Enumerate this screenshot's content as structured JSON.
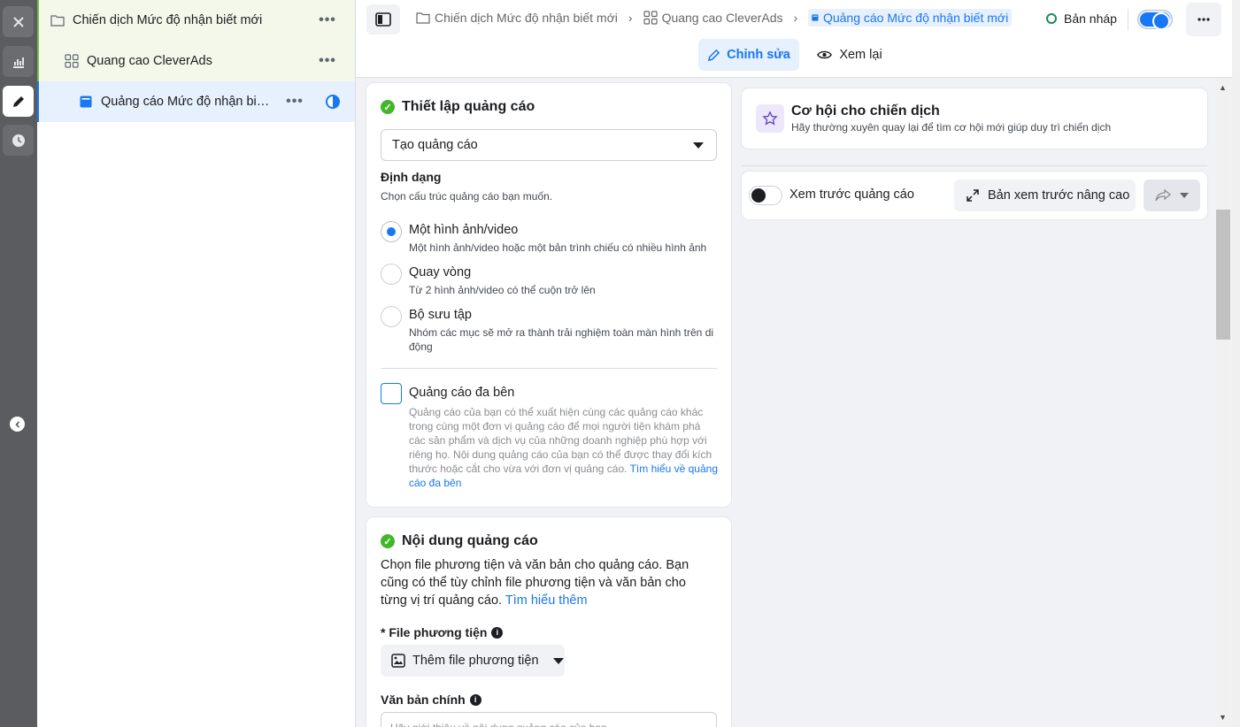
{
  "tree": {
    "campaign": "Chiến dịch Mức độ nhận biết mới",
    "adset": "Quang cao CleverAds",
    "ad": "Quảng cáo Mức độ nhận biết ..."
  },
  "topbar": {
    "breadcrumbs": [
      "Chiến dịch Mức độ nhận biết mới",
      "Quang cao CleverAds",
      "Quảng cáo Mức độ nhận biết mới"
    ],
    "status": "Bản nháp",
    "mode_edit": "Chỉnh sửa",
    "mode_review": "Xem lại"
  },
  "setup": {
    "title": "Thiết lập quảng cáo",
    "create_select": "Tạo quảng cáo",
    "format_heading": "Định dạng",
    "format_sub": "Chọn cấu trúc quảng cáo bạn muốn.",
    "options": [
      {
        "label": "Một hình ảnh/video",
        "desc": "Một hình ảnh/video hoặc một bản trình chiếu có nhiều hình ảnh",
        "selected": true
      },
      {
        "label": "Quay vòng",
        "desc": "Từ 2 hình ảnh/video có thể cuộn trở lên",
        "selected": false
      },
      {
        "label": "Bộ sưu tập",
        "desc": "Nhóm các mục sẽ mở ra thành trải nghiệm toàn màn hình trên di động",
        "selected": false
      }
    ],
    "multi_ad_label": "Quảng cáo đa bên",
    "multi_ad_desc": "Quảng cáo của bạn có thể xuất hiện cùng các quảng cáo khác trong cùng một đơn vị quảng cáo để mọi người tiện khám phá các sản phẩm và dịch vụ của những doanh nghiệp phù hợp với riêng họ. Nội dung quảng cáo của bạn có thể được thay đổi kích thước hoặc cắt cho vừa với đơn vị quảng cáo.",
    "multi_ad_link": "Tìm hiểu về quảng cáo đa bên"
  },
  "content": {
    "title": "Nội dung quảng cáo",
    "desc": "Chọn file phương tiện và văn bản cho quảng cáo. Bạn cũng có thể tùy chỉnh file phương tiện và văn bản cho từng vị trí quảng cáo.",
    "learn_more": "Tìm hiểu thêm",
    "media_label": "* File phương tiện",
    "media_button": "Thêm file phương tiện",
    "primary_text_label": "Văn bản chính",
    "primary_text_placeholder": "Hãy giới thiệu về nội dung quảng cáo của bạn"
  },
  "opportunity": {
    "title": "Cơ hội cho chiến dịch",
    "sub": "Hãy thường xuyên quay lại để tìm cơ hội mới giúp duy trì chiến dịch"
  },
  "preview": {
    "label": "Xem trước quảng cáo",
    "advanced": "Bản xem trước nâng cao"
  },
  "colors": {
    "accent": "#1877f2",
    "success": "#42b72a",
    "rail": "#5a5c5f"
  }
}
